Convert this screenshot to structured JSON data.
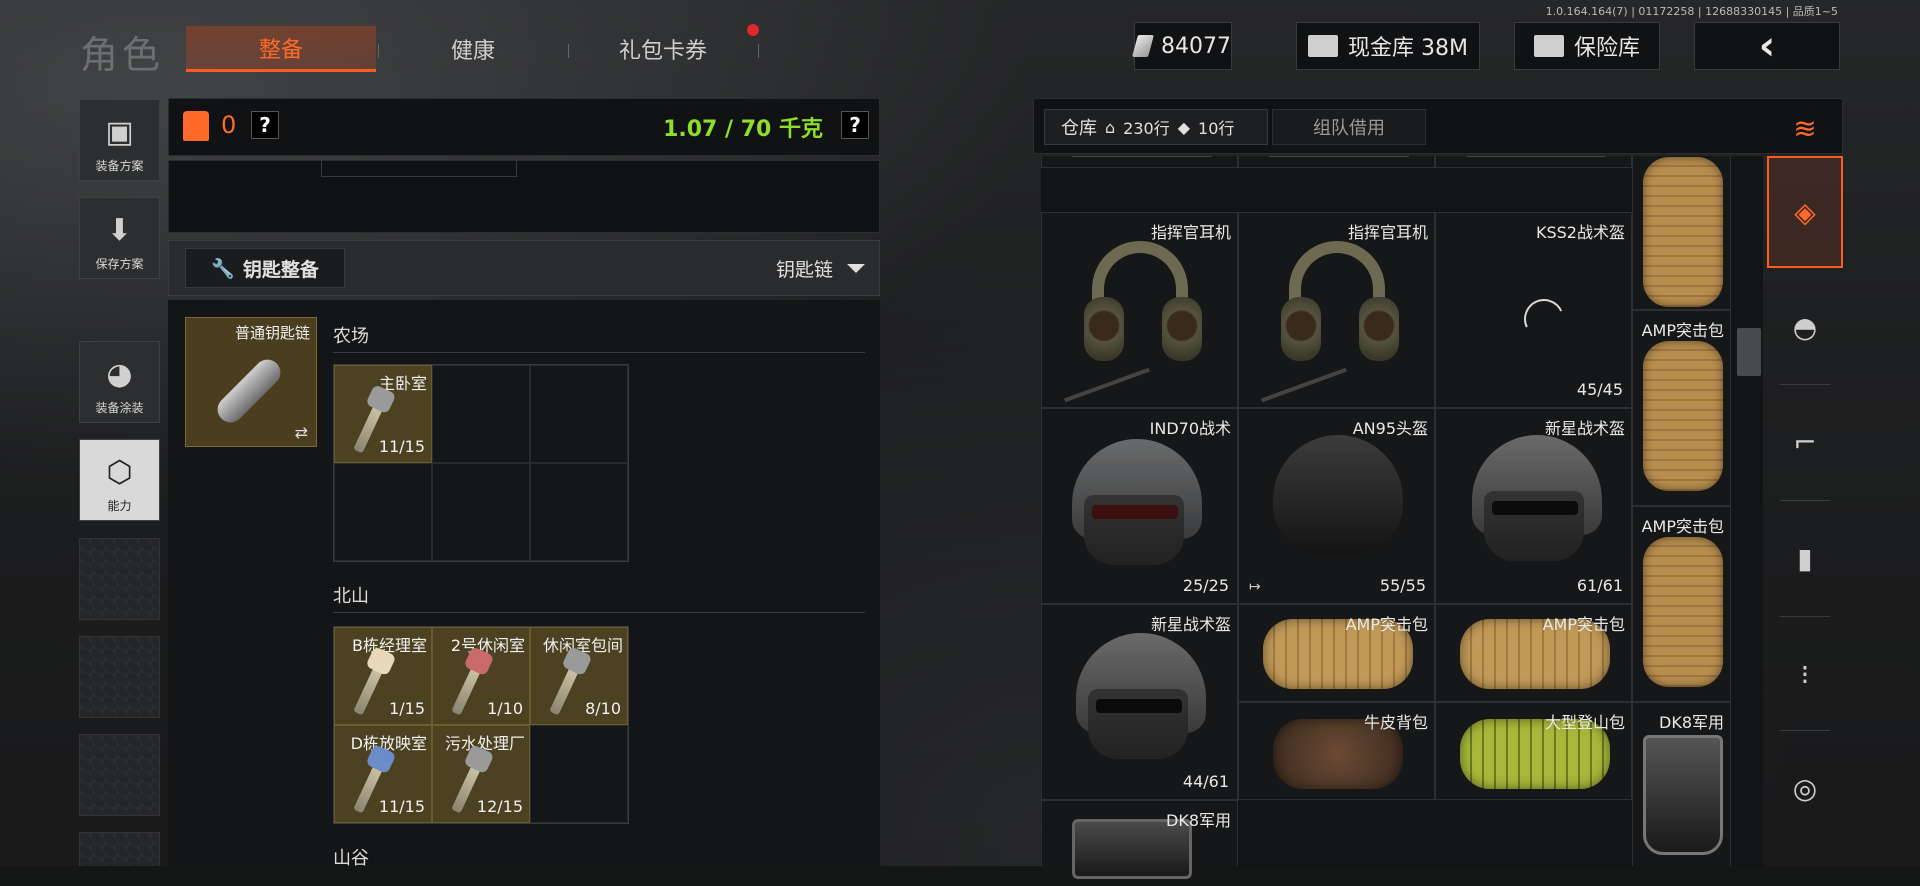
{
  "version": "1.0.164.164(7) | 01172258 | 12688330145 | 品质1~5",
  "header": {
    "title": "角色",
    "tabs": [
      {
        "label": "整备",
        "active": true
      },
      {
        "label": "健康",
        "active": false
      },
      {
        "label": "礼包卡券",
        "active": false,
        "badge": true
      }
    ],
    "currency": "84077",
    "cash_vault": "现金库 38M",
    "insurance": "保险库",
    "back_icon": "chevron-left-icon"
  },
  "left_nav": [
    {
      "label": "装备方案",
      "icon": "vest-icon"
    },
    {
      "label": "保存方案",
      "icon": "download-icon"
    },
    {
      "label": "装备涂装",
      "icon": "helmet-paint-icon"
    },
    {
      "label": "能力",
      "icon": "lightning-hex-icon",
      "active": true
    }
  ],
  "loadout": {
    "armor_count": "0",
    "help": "?",
    "weight": "1.07 / 70 千克"
  },
  "keys": {
    "button_label": "钥匙整备",
    "dropdown_label": "钥匙链",
    "keychain_label": "普通钥匙链",
    "swap_icon": "⇄",
    "regions": [
      {
        "name": "农场",
        "items": [
          {
            "name": "主卧室",
            "count": "11/15"
          }
        ]
      },
      {
        "name": "北山",
        "items": [
          {
            "name": "B栋经理室",
            "count": "1/15"
          },
          {
            "name": "2号休闲室",
            "count": "1/10"
          },
          {
            "name": "休闲室包间",
            "count": "8/10"
          },
          {
            "name": "D栋放映室",
            "count": "11/15"
          },
          {
            "name": "污水处理厂",
            "count": "12/15"
          }
        ]
      },
      {
        "name": "山谷",
        "items": []
      }
    ]
  },
  "warehouse": {
    "tab_label": "仓库",
    "rows_home": "230行",
    "rows_ticket": "10行",
    "team_tab": "组队借用",
    "items": [
      {
        "name": "指挥官耳机",
        "count": ""
      },
      {
        "name": "指挥官耳机",
        "count": ""
      },
      {
        "name": "KSS2战术盔",
        "count": "45/45"
      },
      {
        "name": "AMP突击包",
        "count": ""
      },
      {
        "name": "IND70战术",
        "count": "25/25"
      },
      {
        "name": "AN95头盔",
        "count": "55/55"
      },
      {
        "name": "新星战术盔",
        "count": "61/61"
      },
      {
        "name": "AMP突击包",
        "count": ""
      },
      {
        "name": "新星战术盔",
        "count": "44/61"
      },
      {
        "name": "AMP突击包",
        "count": ""
      },
      {
        "name": "AMP突击包",
        "count": ""
      },
      {
        "name": "牛皮背包",
        "count": ""
      },
      {
        "name": "大型登山包",
        "count": ""
      },
      {
        "name": "DK8军用",
        "count": ""
      },
      {
        "name": "DK8军用",
        "count": ""
      }
    ]
  },
  "right_tabs": [
    "stack-refresh-icon",
    "layers-icon",
    "helmet-icon",
    "rifle-icon",
    "magazine-icon",
    "ammo-icon",
    "scope-icon"
  ],
  "colors": {
    "accent": "#ff5a20",
    "weight": "#8fdc2a",
    "key_bg": "#4c4120"
  }
}
